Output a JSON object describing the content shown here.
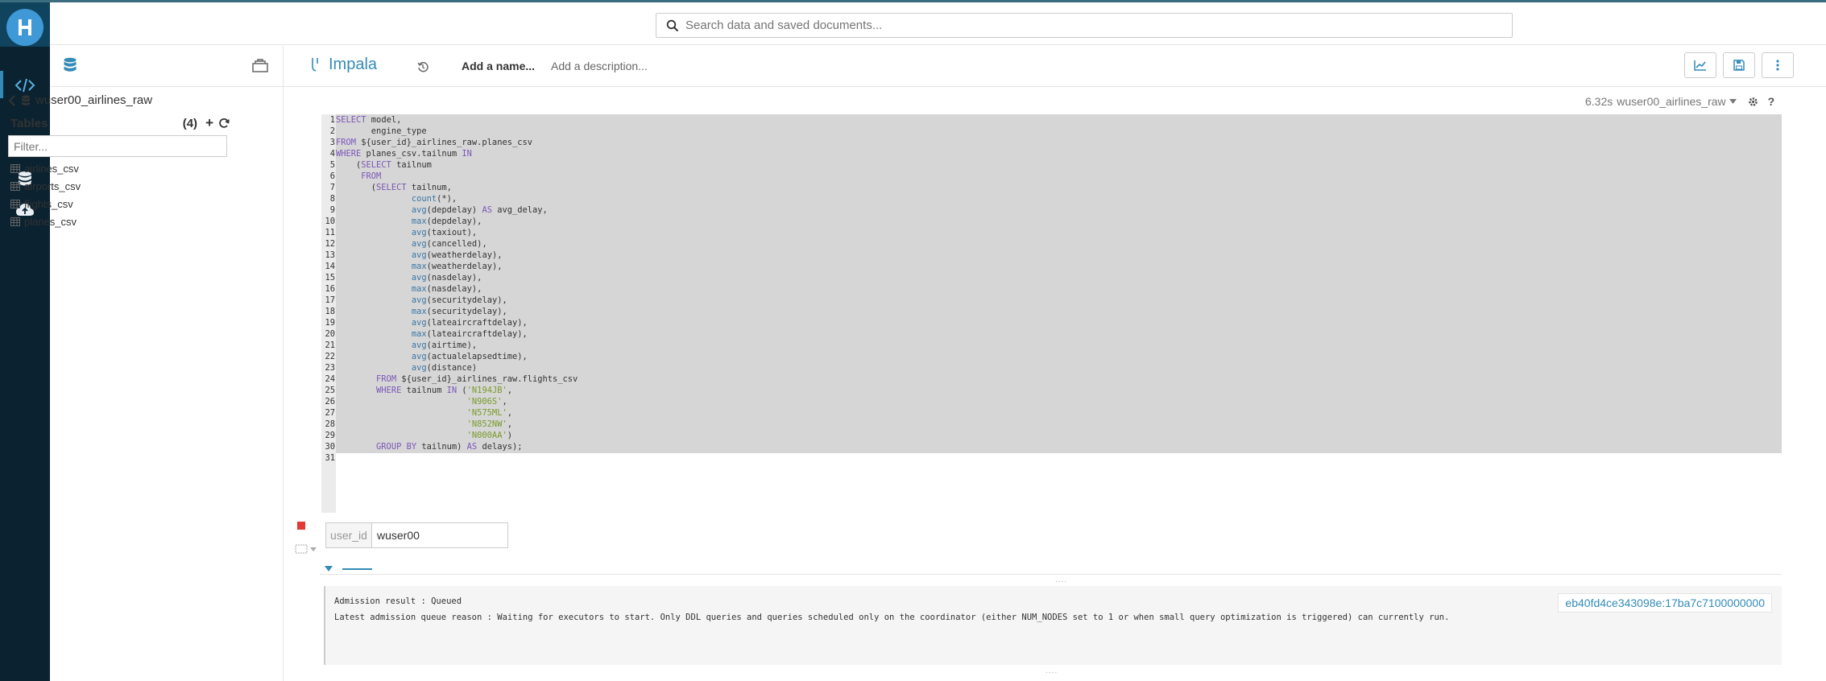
{
  "search": {
    "placeholder": "Search data and saved documents..."
  },
  "assist": {
    "database": "wuser00_airlines_raw",
    "tables_label": "Tables",
    "tables_count": "(4)",
    "filter_placeholder": "Filter...",
    "tables": [
      "airlines_csv",
      "airports_csv",
      "flights_csv",
      "planes_csv"
    ]
  },
  "editor_header": {
    "engine": "Impala",
    "name_placeholder": "Add a name...",
    "description_placeholder": "Add a description..."
  },
  "exec_info": {
    "time": "6.32s",
    "database": "wuser00_airlines_raw"
  },
  "code_lines": [
    "SELECT model,",
    "       engine_type",
    "FROM ${user_id}_airlines_raw.planes_csv",
    "WHERE planes_csv.tailnum IN",
    "    (SELECT tailnum",
    "     FROM",
    "       (SELECT tailnum,",
    "               count(*),",
    "               avg(depdelay) AS avg_delay,",
    "               max(depdelay),",
    "               avg(taxiout),",
    "               avg(cancelled),",
    "               avg(weatherdelay),",
    "               max(weatherdelay),",
    "               avg(nasdelay),",
    "               max(nasdelay),",
    "               avg(securitydelay),",
    "               max(securitydelay),",
    "               avg(lateaircraftdelay),",
    "               max(lateaircraftdelay),",
    "               avg(airtime),",
    "               avg(actualelapsedtime),",
    "               avg(distance)",
    "        FROM ${user_id}_airlines_raw.flights_csv",
    "        WHERE tailnum IN ('N194JB',",
    "                          'N906S',",
    "                          'N575ML',",
    "                          'N852NW',",
    "                          'N000AA')",
    "        GROUP BY tailnum) AS delays);",
    ""
  ],
  "parameter": {
    "label": "user_id",
    "value": "wuser00"
  },
  "result": {
    "line1": "Admission result : Queued",
    "line2": "Latest admission queue reason : Waiting for executors to start. Only DDL queries and queries scheduled only on the coordinator (either NUM_NODES set to 1 or when small query optimization is triggered) can currently run.",
    "query_id": "eb40fd4ce343098e:17ba7c7100000000"
  },
  "colors": {
    "nav": "#0b2230",
    "accent": "#338bb8",
    "logo": "#3f99d6",
    "stop": "#e53935"
  }
}
